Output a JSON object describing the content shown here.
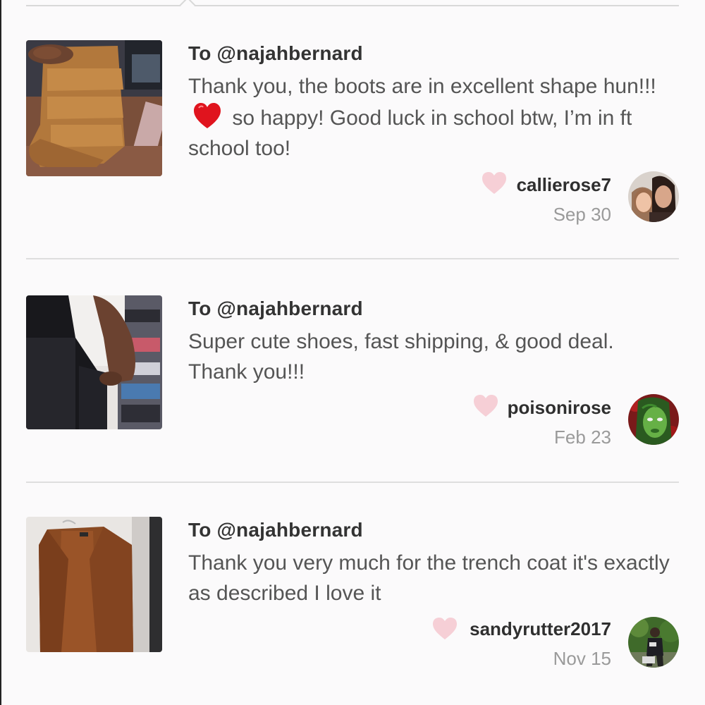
{
  "reviews": [
    {
      "to": "To @najahbernard",
      "message_part1": "Thank you, the boots are in excellent shape hun!!!",
      "message_part2": "so happy! Good luck in school btw, I’m in ft school too!",
      "username": "callierose7",
      "date": "Sep 30",
      "thumbnail_icon": "suede-fringe-boots-photo",
      "avatar_icon": "two-women-selfie-avatar"
    },
    {
      "to": "To @najahbernard",
      "message": "Super cute shoes, fast shipping, & good deal. Thank you!!!",
      "username": "poisonirose",
      "date": "Feb 23",
      "thumbnail_icon": "black-fringe-boots-photo",
      "avatar_icon": "poison-ivy-avatar"
    },
    {
      "to": "To @najahbernard",
      "message": "Thank you very much for the trench coat it's exactly as described I love it",
      "username": "sandyrutter2017",
      "date": "Nov 15",
      "thumbnail_icon": "brown-trench-coat-photo",
      "avatar_icon": "person-outdoors-avatar"
    }
  ],
  "colors": {
    "background": "#fbfafb",
    "like_heart": "#f6cfd6",
    "emoji_heart": "#e0141e",
    "divider": "#dedede"
  }
}
